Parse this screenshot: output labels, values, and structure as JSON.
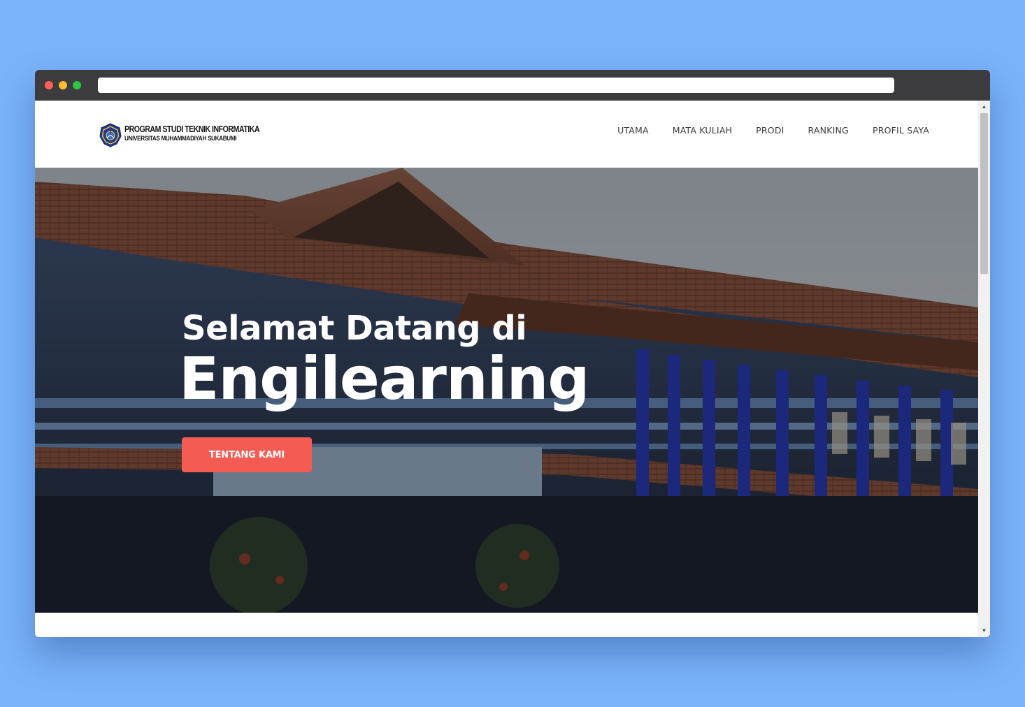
{
  "browser": {
    "url": ""
  },
  "logo": {
    "line1": "PROGRAM STUDI TEKNIK INFORMATIKA",
    "line2": "UNIVERSITAS MUHAMMADIYAH SUKABUMI"
  },
  "nav": {
    "items": [
      {
        "label": "UTAMA"
      },
      {
        "label": "MATA KULIAH"
      },
      {
        "label": "PRODI"
      },
      {
        "label": "RANKING"
      },
      {
        "label": "PROFIL SAYA"
      }
    ]
  },
  "hero": {
    "line1": "Selamat Datang di",
    "line2": "Engilearning",
    "button_label": "TENTANG KAMI"
  },
  "colors": {
    "page_background": "#7ab3fb",
    "titlebar": "#3c3c3e",
    "accent_button": "#f45b52"
  }
}
